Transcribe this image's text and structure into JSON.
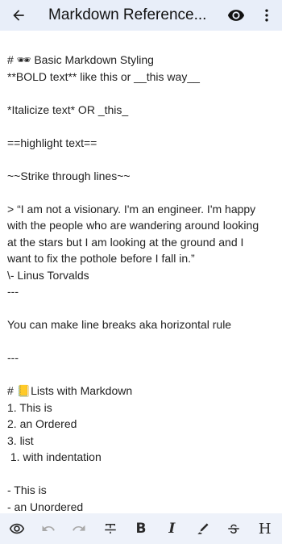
{
  "appbar": {
    "back_icon": "arrow-left-icon",
    "title": "Markdown Reference...",
    "preview_icon": "eye-icon",
    "menu_icon": "more-vertical-icon"
  },
  "editor": {
    "lines": [
      "# 🕶 Basic Markdown Styling",
      "**BOLD text** like this or __this way__",
      "",
      "*Italicize text* OR _this_",
      "",
      "==highlight text==",
      "",
      "~~Strike through lines~~",
      "",
      "> “I am not a visionary. I'm an engineer. I'm happy",
      "with the people who are wandering around looking",
      "at the stars but I am looking at the ground and I",
      "want to fix the pothole before I fall in.”",
      "\\- Linus Torvalds",
      "---",
      "",
      "You can make line breaks aka horizontal rule",
      "",
      "---",
      "",
      "# 📒Lists with Markdown",
      "1. This is",
      "2. an Ordered",
      "3. list",
      " 1. with indentation",
      "",
      "- This is",
      "- an Unordered"
    ]
  },
  "toolbar": {
    "preview_icon": "eye-icon",
    "undo_icon": "undo-icon",
    "redo_icon": "redo-icon",
    "text_format_icon": "text-format-icon",
    "bold_label": "B",
    "italic_label": "I",
    "highlight_icon": "highlighter-icon",
    "strike_icon": "strikethrough-icon",
    "heading_label": "H"
  }
}
